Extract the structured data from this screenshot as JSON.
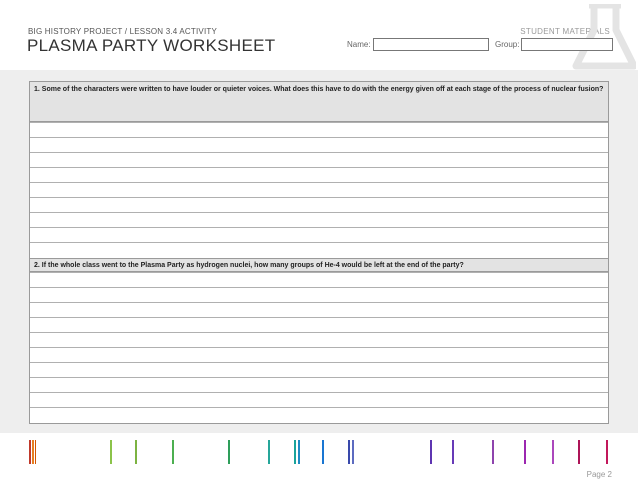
{
  "header": {
    "breadcrumb": "BIG HISTORY PROJECT / LESSON 3.4 ACTIVITY",
    "title": "PLASMA PARTY WORKSHEET",
    "student_materials": "STUDENT MATERIALS",
    "name_label": "Name:",
    "group_label": "Group:"
  },
  "questions": [
    {
      "text": "1. Some of the characters were written to have louder or quieter voices. What does this have to do with the energy given off at each stage of the process of nuclear fusion?"
    },
    {
      "text": "2. If the whole class went to the Plasma Party as hydrogen nuclei, how many groups of He-4 would be left at the end of the party?"
    }
  ],
  "footer": {
    "page": "Page 2"
  },
  "colors": {
    "spectrum": [
      "#c0392b",
      "#e67e22",
      "#8bc34a",
      "#4caf50",
      "#2e9e5a",
      "#1aa39a",
      "#1e8bc3",
      "#5c6bc0",
      "#8e44ad",
      "#9c27b0",
      "#c2185b"
    ]
  }
}
